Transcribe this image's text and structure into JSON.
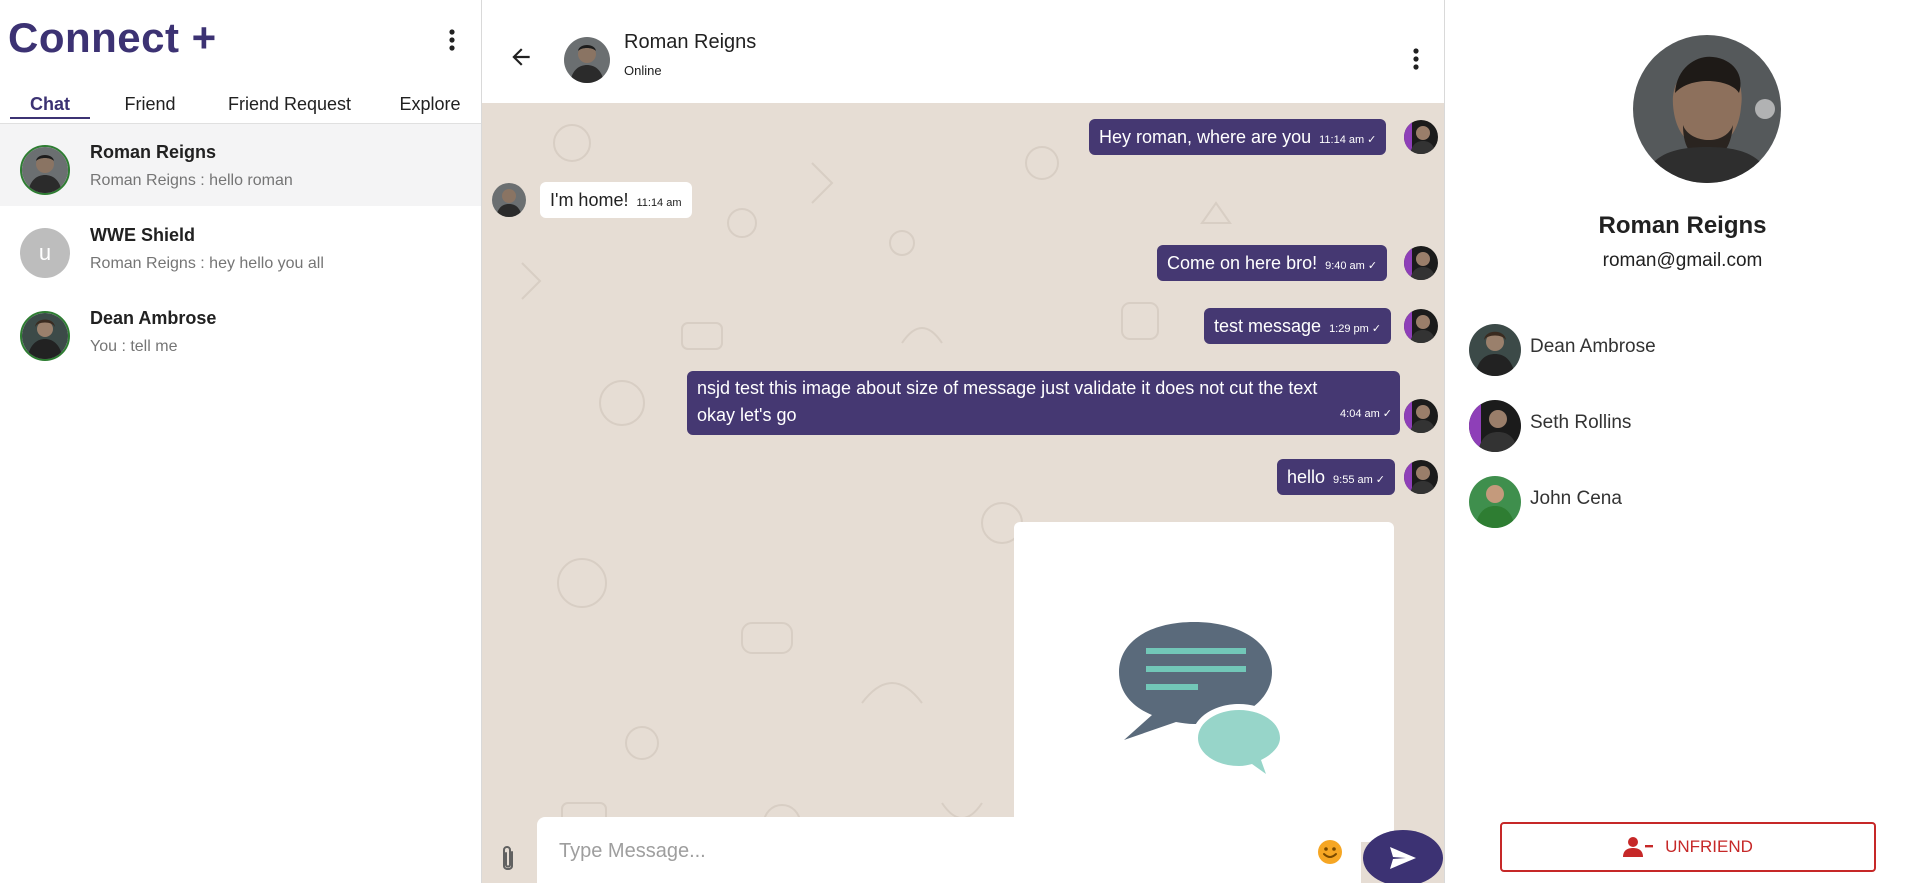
{
  "app": {
    "title": "Connect +"
  },
  "tabs": [
    {
      "label": "Chat",
      "active": true
    },
    {
      "label": "Friend",
      "active": false
    },
    {
      "label": "Friend Request",
      "active": false
    },
    {
      "label": "Explore",
      "active": false
    }
  ],
  "chat_list": [
    {
      "name": "Roman Reigns",
      "last_message": "Roman Reigns : hello roman",
      "avatar": "photo",
      "active": true
    },
    {
      "name": "WWE Shield",
      "last_message": "Roman Reigns : hey hello you all",
      "avatar_letter": "u",
      "active": false
    },
    {
      "name": "Dean Ambrose",
      "last_message": "You : tell me",
      "avatar": "photo",
      "active": false
    }
  ],
  "chat_header": {
    "name": "Roman Reigns",
    "status": "Online"
  },
  "messages": [
    {
      "direction": "out",
      "text": "Hey roman, where are you",
      "time": "11:14 am",
      "status": "✓"
    },
    {
      "direction": "in",
      "text": "I'm home!",
      "time": "11:14 am"
    },
    {
      "direction": "out",
      "text": "Come on here bro!",
      "time": "9:40 am",
      "status": "✓"
    },
    {
      "direction": "out",
      "text": "test message",
      "time": "1:29 pm",
      "status": "✓"
    },
    {
      "direction": "out",
      "text": "nsjd test this image about size of message just validate it does not cut the text okay let's go",
      "time": "4:04 am",
      "status": "✓"
    },
    {
      "direction": "out",
      "text": "hello",
      "time": "9:55 am",
      "status": "✓"
    },
    {
      "direction": "out",
      "type": "image",
      "image": "chat-bubbles-illustration"
    }
  ],
  "composer": {
    "placeholder": "Type Message..."
  },
  "profile": {
    "name": "Roman Reigns",
    "email": "roman@gmail.com",
    "friends": [
      {
        "name": "Dean Ambrose"
      },
      {
        "name": "Seth Rollins"
      },
      {
        "name": "John Cena"
      }
    ],
    "unfriend_label": "UNFRIEND"
  },
  "colors": {
    "brand": "#3c3273",
    "outgoing_bubble": "#453872",
    "chat_background": "#e6ddd4",
    "danger": "#c62828",
    "active_row": "#f4f4f5"
  },
  "icons": [
    "more-vert-icon",
    "back-arrow-icon",
    "attach-icon",
    "emoji-icon",
    "send-icon",
    "remove-user-icon"
  ]
}
